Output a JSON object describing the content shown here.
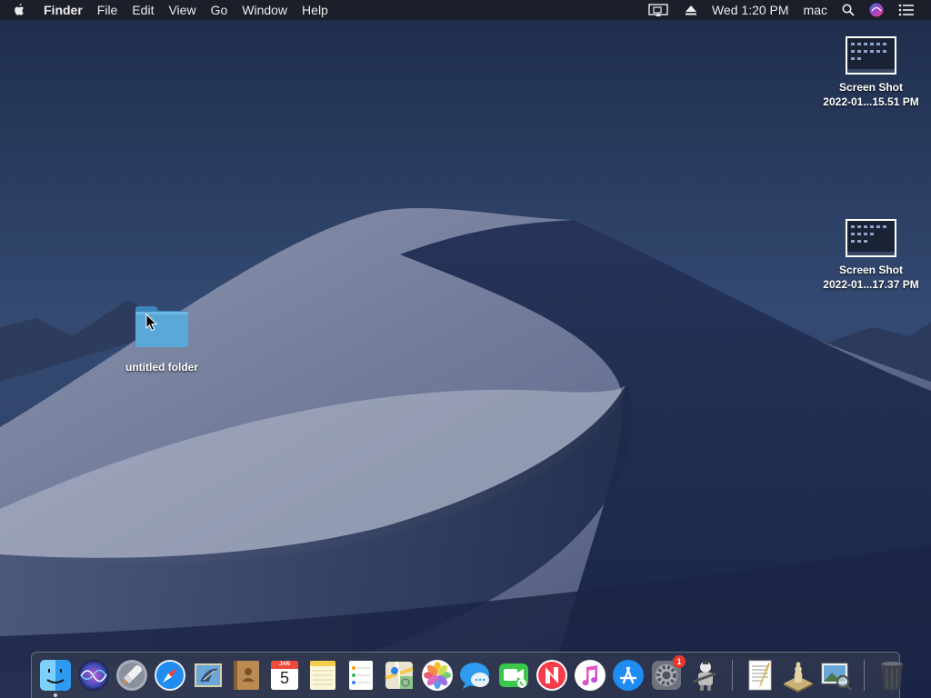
{
  "menubar": {
    "app_name": "Finder",
    "menus": [
      "File",
      "Edit",
      "View",
      "Go",
      "Window",
      "Help"
    ],
    "clock": "Wed 1:20 PM",
    "user": "mac"
  },
  "desktop": {
    "icons": [
      {
        "name": "Screen Shot",
        "subtitle": "2022-01...15.51 PM"
      },
      {
        "name": "Screen Shot",
        "subtitle": "2022-01...17.37 PM"
      },
      {
        "name": "untitled folder"
      }
    ]
  },
  "dock": {
    "apps": [
      {
        "icon": "finder-icon",
        "running": true
      },
      {
        "icon": "siri-icon"
      },
      {
        "icon": "launchpad-icon"
      },
      {
        "icon": "safari-icon"
      },
      {
        "icon": "mail-icon"
      },
      {
        "icon": "contacts-icon"
      },
      {
        "icon": "calendar-icon",
        "calendar_month": "JAN",
        "calendar_day": "5"
      },
      {
        "icon": "notes-icon"
      },
      {
        "icon": "reminders-icon"
      },
      {
        "icon": "maps-icon"
      },
      {
        "icon": "photos-icon"
      },
      {
        "icon": "messages-icon"
      },
      {
        "icon": "facetime-icon"
      },
      {
        "icon": "news-icon"
      },
      {
        "icon": "itunes-icon"
      },
      {
        "icon": "app-store-icon"
      },
      {
        "icon": "system-preferences-icon",
        "badge": "1"
      },
      {
        "icon": "automator-icon"
      },
      {
        "icon": "textedit-icon"
      },
      {
        "icon": "chess-icon"
      },
      {
        "icon": "preview-icon"
      },
      {
        "icon": "trash-icon"
      }
    ]
  },
  "colors": {
    "menubar_bg": "#1c1e26",
    "folder_blue": "#5aa8d8",
    "badge_red": "#e8362b"
  }
}
